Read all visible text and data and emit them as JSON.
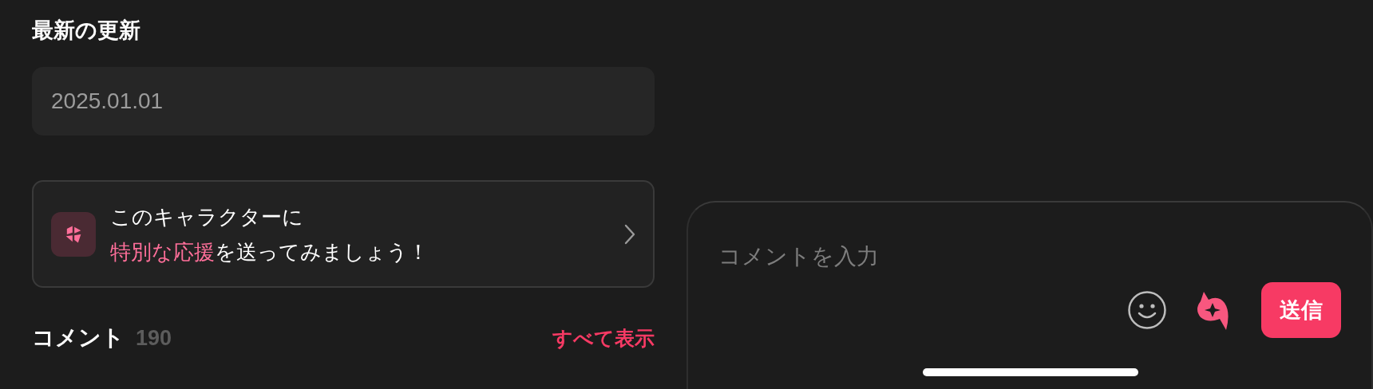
{
  "section_title": "最新の更新",
  "update_date": "2025.01.01",
  "promo_card": {
    "lines": [
      [
        {
          "text": "このキャラクターに",
          "highlight": false
        }
      ],
      [
        {
          "text": "特別な応援",
          "highlight": true
        },
        {
          "text": "を送ってみましょう！",
          "highlight": false
        }
      ]
    ]
  },
  "comments": {
    "label": "コメント",
    "count": "190",
    "link": "すべて表示"
  },
  "composer": {
    "placeholder": "コメントを入力",
    "send_button": "送信"
  }
}
